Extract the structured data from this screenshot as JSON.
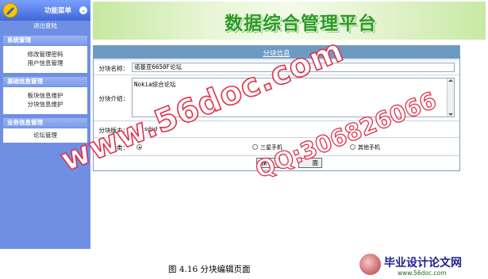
{
  "sidebar": {
    "title": "功能菜单",
    "toggle_glyph": "⌄",
    "logout": "退出登陆",
    "sections": [
      {
        "title": "系统管理",
        "items": [
          "修改管理密码",
          "用户信息管理"
        ]
      },
      {
        "title": "基础信息管理",
        "items": [
          "板块信息维护",
          "分块信息维护"
        ]
      },
      {
        "title": "业务信息管理",
        "items": [
          "论坛管理"
        ]
      }
    ]
  },
  "banner": {
    "title": "数据综合管理平台"
  },
  "form": {
    "header": "分块信息",
    "name_label": "分块名称：",
    "name_value": "诺基亚6650F论坛",
    "intro_label": "分块介绍：",
    "intro_value": "Nokia综合论坛",
    "moderator_label": "分块版主：",
    "moderator_option": "sdsd",
    "category_label": "分类：",
    "categories": [
      "",
      "三星手机",
      "其他手机"
    ],
    "buttons": [
      "保",
      "面"
    ]
  },
  "caption": "图 4.16 分块编辑页面",
  "watermarks": {
    "url": "www.56doc.com",
    "qq": "QQ:306826066",
    "logo_text": "毕业设计论文网",
    "logo_url": "www.56doc.com"
  }
}
